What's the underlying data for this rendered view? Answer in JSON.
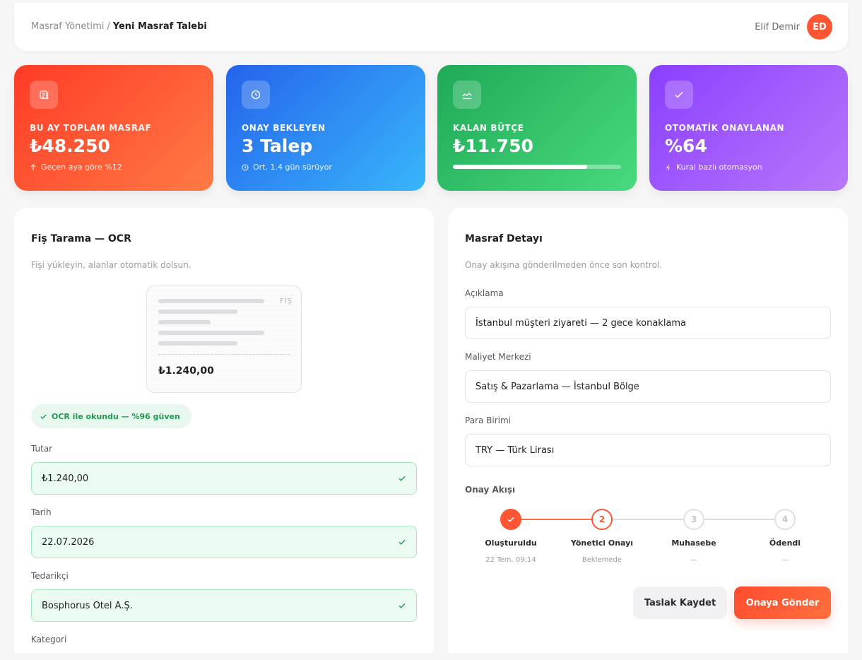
{
  "header": {
    "breadcrumb_parent": "Masraf Yönetimi",
    "breadcrumb_sep": "/",
    "breadcrumb_current": "Yeni Masraf Talebi",
    "user_name": "Elif Demir",
    "user_initials": "ED"
  },
  "stats": [
    {
      "label": "BU AY TOPLAM MASRAF",
      "value": "₺48.250",
      "sub": "Geçen aya göre %12",
      "icon": "coins-icon",
      "sub_icon": "arrow-up-icon"
    },
    {
      "label": "ONAY BEKLEYEN",
      "value": "3 Talep",
      "sub": "Ort. 1.4 gün sürüyor",
      "icon": "clock-icon",
      "sub_icon": "clock-small-icon"
    },
    {
      "label": "KALAN BÜTÇE",
      "value": "₺11.750",
      "progress": 0.8,
      "icon": "trend-icon"
    },
    {
      "label": "OTOMATİK ONAYLANAN",
      "value": "%64",
      "sub": "Kural bazlı otomasyon",
      "icon": "check-icon",
      "sub_icon": "bolt-icon"
    }
  ],
  "ocr": {
    "title": "Fiş Tarama — OCR",
    "subtitle": "Fişi yükleyin, alanlar otomatik dolsun.",
    "receipt_tag": "FİŞ",
    "receipt_total": "₺1.240,00",
    "badge": "OCR ile okundu — %96 güven",
    "fields": [
      {
        "label": "Tutar",
        "value": "₺1.240,00"
      },
      {
        "label": "Tarih",
        "value": "22.07.2026"
      },
      {
        "label": "Tedarikçi",
        "value": "Bosphorus Otel A.Ş."
      }
    ],
    "next_label": "Kategori"
  },
  "detail": {
    "title": "Masraf Detayı",
    "subtitle": "Onay akışına gönderilmeden önce son kontrol.",
    "fields": [
      {
        "label": "Açıklama",
        "value": "İstanbul müşteri ziyareti — 2 gece konaklama"
      },
      {
        "label": "Maliyet Merkezi",
        "value": "Satış & Pazarlama — İstanbul Bölge"
      },
      {
        "label": "Para Birimi",
        "value": "TRY — Türk Lirası"
      }
    ],
    "flow_label": "Onay Akışı",
    "steps": [
      {
        "number": "1",
        "label": "Oluşturuldu",
        "time": "22 Tem, 09:14",
        "state": "done"
      },
      {
        "number": "2",
        "label": "Yönetici Onayı",
        "time": "Beklemede",
        "state": "active"
      },
      {
        "number": "3",
        "label": "Muhasebe",
        "time": "—",
        "state": "pending"
      },
      {
        "number": "4",
        "label": "Ödendi",
        "time": "—",
        "state": "pending"
      }
    ],
    "draft_button": "Taslak Kaydet",
    "submit_button": "Onaya Gönder"
  },
  "colors": {
    "accent": "#ff5533",
    "success": "#1e9a50",
    "pending": "#d8d8dd"
  }
}
